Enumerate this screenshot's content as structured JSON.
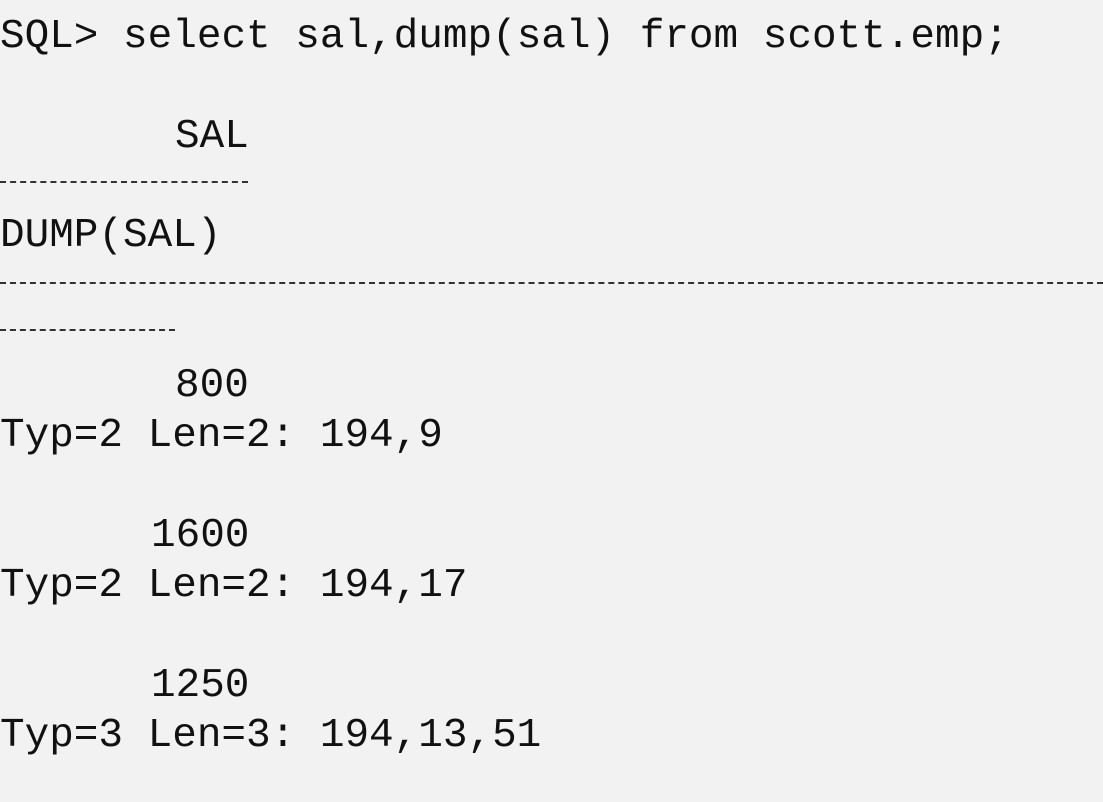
{
  "terminal": {
    "prompt": "SQL>",
    "command": "select sal,dump(sal) from scott.emp;",
    "headers": {
      "sal": "SAL",
      "dump": "DUMP(SAL)"
    },
    "rows": [
      {
        "sal": "800",
        "dump": "Typ=2 Len=2: 194,9"
      },
      {
        "sal": "1600",
        "dump": "Typ=2 Len=2: 194,17"
      },
      {
        "sal": "1250",
        "dump": "Typ=3 Len=3: 194,13,51"
      }
    ]
  }
}
